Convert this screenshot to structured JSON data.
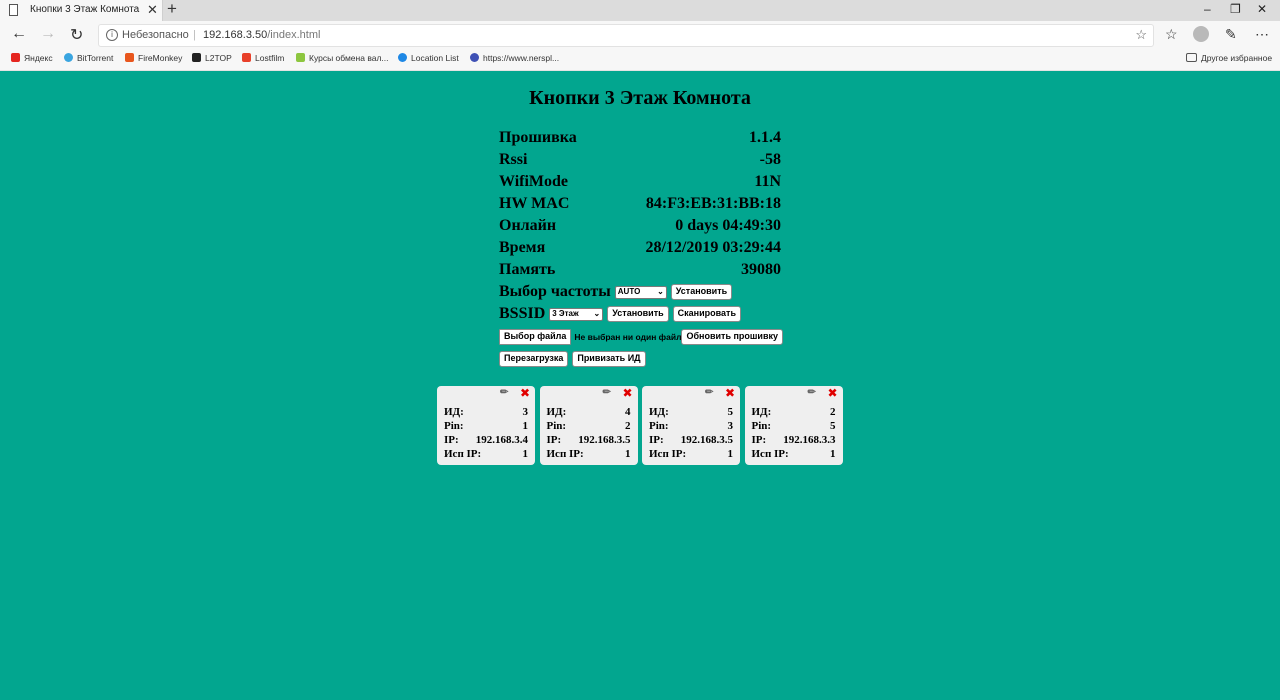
{
  "browser": {
    "tab_title": "Кнопки 3 Этаж Комнота",
    "security_label": "Небезопасно",
    "url_host": "192.168.3.50",
    "url_path": "/index.html",
    "bookmarks": [
      {
        "label": "Яндекс",
        "icon_color": "#e52620"
      },
      {
        "label": "BitTorrent",
        "icon_color": "#3aa5e0"
      },
      {
        "label": "FireMonkey",
        "icon_color": "#e8561d"
      },
      {
        "label": "L2TOP",
        "icon_color": "#222222"
      },
      {
        "label": "Lostfilm",
        "icon_color": "#e8402a"
      },
      {
        "label": "Курсы обмена вал...",
        "icon_color": "#8dc63f"
      },
      {
        "label": "Location List",
        "icon_color": "#1e88e5"
      },
      {
        "label": "https://www.nerspl...",
        "icon_color": "#3f51b5"
      }
    ],
    "other_bookmarks": "Другое избранное"
  },
  "page": {
    "title": "Кнопки 3 Этаж Комнота",
    "info": [
      {
        "label": "Прошивка",
        "value": "1.1.4"
      },
      {
        "label": "Rssi",
        "value": "-58"
      },
      {
        "label": "WifiMode",
        "value": "11N"
      },
      {
        "label": "HW MAC",
        "value": "84:F3:EB:31:BB:18"
      },
      {
        "label": "Онлайн",
        "value": "0 days 04:49:30"
      },
      {
        "label": "Время",
        "value": "28/12/2019 03:29:44"
      },
      {
        "label": "Память",
        "value": "39080"
      }
    ],
    "freq": {
      "label": "Выбор частоты",
      "selected": "AUTO",
      "set_button": "Установить"
    },
    "bssid": {
      "label": "BSSID",
      "selected": "3 Этаж",
      "set_button": "Установить",
      "scan_button": "Сканировать"
    },
    "firmware": {
      "choose_file": "Выбор файла",
      "no_file": "Не выбран ни один файл",
      "update_button": "Обновить прошивку"
    },
    "actions": {
      "reboot": "Перезагрузка",
      "bind_id": "Привизать ИД"
    },
    "card_labels": {
      "id": "ИД:",
      "pin": "Pin:",
      "ip": "IP:",
      "use_ip": "Исп IP:"
    },
    "cards": [
      {
        "id": "3",
        "pin": "1",
        "ip": "192.168.3.4",
        "use_ip": "1"
      },
      {
        "id": "4",
        "pin": "2",
        "ip": "192.168.3.5",
        "use_ip": "1"
      },
      {
        "id": "5",
        "pin": "3",
        "ip": "192.168.3.5",
        "use_ip": "1"
      },
      {
        "id": "2",
        "pin": "5",
        "ip": "192.168.3.3",
        "use_ip": "1"
      }
    ]
  },
  "colors": {
    "page_background": "#02a68f",
    "card_background": "#efefef",
    "delete_icon": "#e00000"
  }
}
